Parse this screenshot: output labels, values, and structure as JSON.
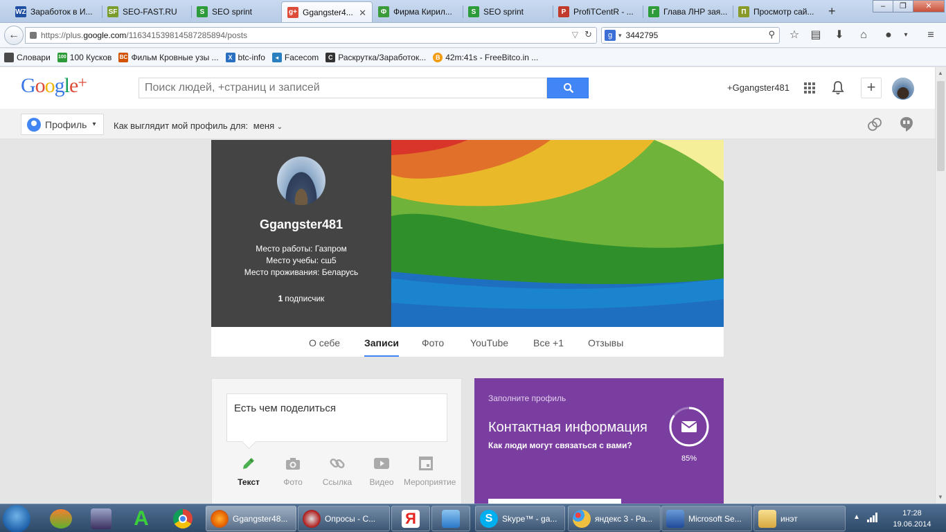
{
  "browser": {
    "tabs": [
      {
        "label": "Заработок в И...",
        "icon_color": "#1f4fa3",
        "icon_text": "WZ"
      },
      {
        "label": "SEO-FAST.RU",
        "icon_color": "#7a9c2a",
        "icon_text": "SF"
      },
      {
        "label": "SEO sprint",
        "icon_color": "#2e9b3a",
        "icon_text": "S"
      },
      {
        "label": "Ggangster4...",
        "icon_color": "#dd4b39",
        "icon_text": "g+",
        "active": true
      },
      {
        "label": "Фирма Кирил...",
        "icon_color": "#3a9b3a",
        "icon_text": "Ф"
      },
      {
        "label": "SEO sprint",
        "icon_color": "#2e9b3a",
        "icon_text": "S"
      },
      {
        "label": "ProfiTCentR - ...",
        "icon_color": "#c0392b",
        "icon_text": "P"
      },
      {
        "label": "Глава ЛНР зая...",
        "icon_color": "#2e9b3a",
        "icon_text": "Г"
      },
      {
        "label": "Просмотр сай...",
        "icon_color": "#8a9a2a",
        "icon_text": "П"
      }
    ],
    "url_prefix": "https://plus.",
    "url_domain": "google.com",
    "url_path": "/116341539814587285894/posts",
    "search_value": "3442795",
    "bookmarks": [
      {
        "label": "Словари",
        "icon_color": "#4a4a4a",
        "icon_text": ""
      },
      {
        "label": "100 Кусков",
        "icon_color": "#2e9b3a",
        "icon_text": "100"
      },
      {
        "label": "Фильм Кровные узы ...",
        "icon_color": "#d35400",
        "icon_text": "BC"
      },
      {
        "label": "btc-info",
        "icon_color": "#2a6fc0",
        "icon_text": "X"
      },
      {
        "label": "Facecom",
        "icon_color": "#2a7fc0",
        "icon_text": "◂"
      },
      {
        "label": "Раскрутка/Заработок...",
        "icon_color": "#333333",
        "icon_text": "C"
      },
      {
        "label": "42m:41s - FreeBitco.in ...",
        "icon_color": "#f39c12",
        "icon_text": "B"
      }
    ]
  },
  "gplus": {
    "search_placeholder": "Поиск людей, +страниц и записей",
    "username": "+Ggangster481",
    "profile_button": "Профиль",
    "view_as_label": "Как выглядит мой профиль для:",
    "view_as_value": "меня",
    "profile": {
      "name": "Ggangster481",
      "work": "Место работы: Газпром",
      "education": "Место учебы: сш5",
      "residence": "Место проживания: Беларусь",
      "followers_count": "1",
      "followers_label": "подписчик"
    },
    "tabs": [
      "О себе",
      "Записи",
      "Фото",
      "YouTube",
      "Все +1",
      "Отзывы"
    ],
    "share_placeholder": "Есть чем поделиться",
    "share_actions": [
      "Текст",
      "Фото",
      "Ссылка",
      "Видео",
      "Мероприятие"
    ],
    "fill_profile": {
      "kicker": "Заполните профиль",
      "title": "Контактная информация",
      "question": "Как люди могут связаться с вами?",
      "percent_label": "85%",
      "percent_value": 0.85
    }
  },
  "taskbar": {
    "items": [
      {
        "label": "Ggangster48...",
        "color": "#e66000",
        "active": true
      },
      {
        "label": "Опросы - С...",
        "color": "#b22222"
      },
      {
        "label": "",
        "color": "#e52620"
      },
      {
        "label": "",
        "color": "#3a8de0"
      },
      {
        "label": "Skype™ - ga...",
        "color": "#00aff0"
      },
      {
        "label": "яндекс 3 - Ра...",
        "color": "#f0c040"
      },
      {
        "label": "Microsoft Se...",
        "color": "#3a6fc0"
      },
      {
        "label": "инэт",
        "color": "#e8c060"
      }
    ],
    "time": "17:28",
    "date": "19.06.2014"
  }
}
